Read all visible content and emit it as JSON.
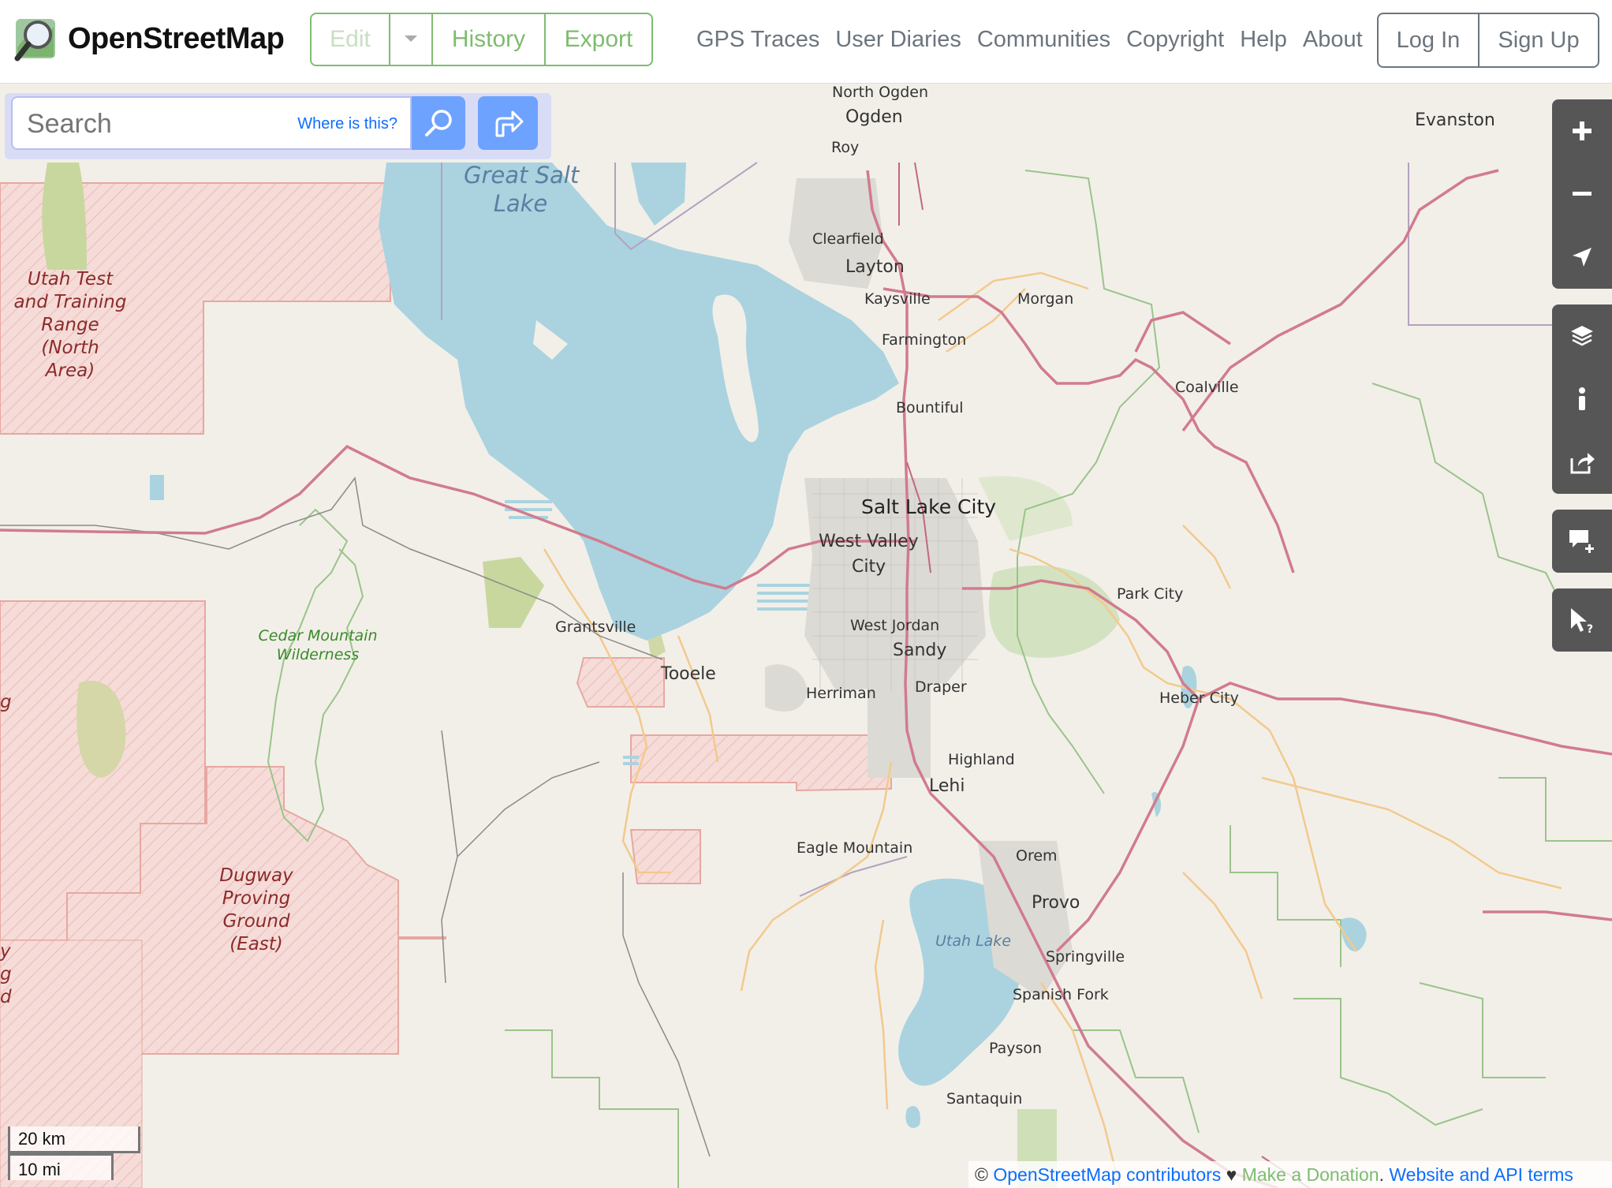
{
  "header": {
    "brand": "OpenStreetMap",
    "edit": "Edit",
    "history": "History",
    "export": "Export",
    "nav": [
      "GPS Traces",
      "User Diaries",
      "Communities",
      "Copyright",
      "Help",
      "About"
    ],
    "login": "Log In",
    "signup": "Sign Up"
  },
  "search": {
    "placeholder": "Search",
    "where": "Where is this?"
  },
  "map": {
    "cities": {
      "north_ogden": "North Ogden",
      "ogden": "Ogden",
      "roy": "Roy",
      "clearfield": "Clearfield",
      "layton": "Layton",
      "kaysville": "Kaysville",
      "farmington": "Farmington",
      "morgan": "Morgan",
      "coalville": "Coalville",
      "evanston": "Evanston",
      "bountiful": "Bountiful",
      "salt_lake_city": "Salt Lake City",
      "west_valley_1": "West Valley",
      "west_valley_2": "City",
      "park_city": "Park City",
      "grantsville": "Grantsville",
      "west_jordan": "West Jordan",
      "sandy": "Sandy",
      "tooele": "Tooele",
      "herriman": "Herriman",
      "draper": "Draper",
      "heber_city": "Heber City",
      "highland": "Highland",
      "lehi": "Lehi",
      "eagle_mountain": "Eagle Mountain",
      "orem": "Orem",
      "provo": "Provo",
      "springville": "Springville",
      "spanish_fork": "Spanish Fork",
      "payson": "Payson",
      "santaquin": "Santaquin"
    },
    "water": {
      "gsl1": "Great Salt",
      "gsl2": "Lake",
      "utah_lake": "Utah Lake"
    },
    "areas": {
      "utah_test": [
        "Utah Test",
        "and Training",
        "Range",
        "(North",
        "Area)"
      ],
      "cedar": [
        "Cedar Mountain",
        "Wilderness"
      ],
      "dugway": [
        "Dugway",
        "Proving",
        "Ground",
        "(East)"
      ]
    },
    "edge_fragments": [
      "g",
      "y",
      "g",
      "d"
    ]
  },
  "scale": {
    "metric": "20 km",
    "imperial": "10 mi"
  },
  "attribution": {
    "prefix": "© ",
    "contributors": "OpenStreetMap contributors",
    "heart": " ♥ ",
    "donate": "Make a Donation",
    "sep": ". ",
    "terms": "Website and API terms"
  },
  "controls": [
    "zoom-in",
    "zoom-out",
    "locate",
    "layers",
    "info",
    "share",
    "add-note",
    "query"
  ]
}
